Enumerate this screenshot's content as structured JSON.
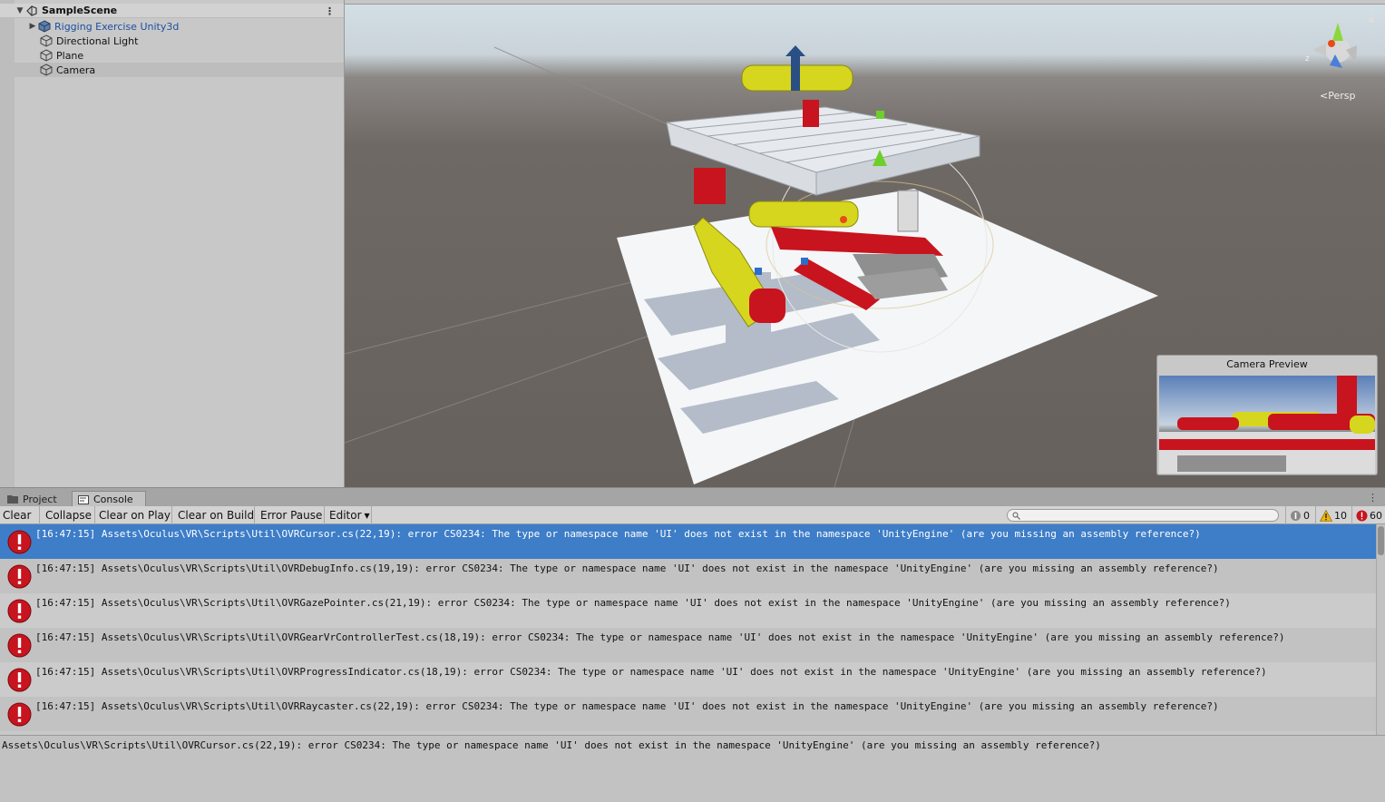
{
  "hierarchy": {
    "scene_name": "SampleScene",
    "items": [
      {
        "label": "Rigging Exercise Unity3d",
        "type": "prefab",
        "expandable": true
      },
      {
        "label": "Directional Light",
        "type": "gameobject"
      },
      {
        "label": "Plane",
        "type": "gameobject"
      },
      {
        "label": "Camera",
        "type": "gameobject",
        "selected": true
      }
    ]
  },
  "scene_view": {
    "projection_label": "Persp",
    "gizmo_axis_label": "z",
    "camera_preview_title": "Camera Preview"
  },
  "tabs": [
    {
      "label": "Project",
      "icon": "folder-icon",
      "active": false
    },
    {
      "label": "Console",
      "icon": "console-icon",
      "active": true
    }
  ],
  "console_toolbar": {
    "clear": "Clear",
    "collapse": "Collapse",
    "clear_on_play": "Clear on Play",
    "clear_on_build": "Clear on Build",
    "error_pause": "Error Pause",
    "editor": "Editor",
    "search_value": "",
    "info_count": "0",
    "warning_count": "10",
    "error_count": "60"
  },
  "log_entries": [
    {
      "text": "[16:47:15] Assets\\Oculus\\VR\\Scripts\\Util\\OVRCursor.cs(22,19): error CS0234: The type or namespace name 'UI' does not exist in the namespace 'UnityEngine' (are you missing an assembly reference?)",
      "selected": true
    },
    {
      "text": "[16:47:15] Assets\\Oculus\\VR\\Scripts\\Util\\OVRDebugInfo.cs(19,19): error CS0234: The type or namespace name 'UI' does not exist in the namespace 'UnityEngine' (are you missing an assembly reference?)"
    },
    {
      "text": "[16:47:15] Assets\\Oculus\\VR\\Scripts\\Util\\OVRGazePointer.cs(21,19): error CS0234: The type or namespace name 'UI' does not exist in the namespace 'UnityEngine' (are you missing an assembly reference?)"
    },
    {
      "text": "[16:47:15] Assets\\Oculus\\VR\\Scripts\\Util\\OVRGearVrControllerTest.cs(18,19): error CS0234: The type or namespace name 'UI' does not exist in the namespace 'UnityEngine' (are you missing an assembly reference?)"
    },
    {
      "text": "[16:47:15] Assets\\Oculus\\VR\\Scripts\\Util\\OVRProgressIndicator.cs(18,19): error CS0234: The type or namespace name 'UI' does not exist in the namespace 'UnityEngine' (are you missing an assembly reference?)"
    },
    {
      "text": "[16:47:15] Assets\\Oculus\\VR\\Scripts\\Util\\OVRRaycaster.cs(22,19): error CS0234: The type or namespace name 'UI' does not exist in the namespace 'UnityEngine' (are you missing an assembly reference?)"
    }
  ],
  "detail": {
    "text": "Assets\\Oculus\\VR\\Scripts\\Util\\OVRCursor.cs(22,19): error CS0234: The type or namespace name 'UI' does not exist in the namespace 'UnityEngine' (are you missing an assembly reference?)"
  },
  "colors": {
    "selection": "#3e7dc7",
    "error_red": "#c8141e",
    "warning_yellow": "#f0b400",
    "prefab_blue": "#1d4fa1"
  }
}
